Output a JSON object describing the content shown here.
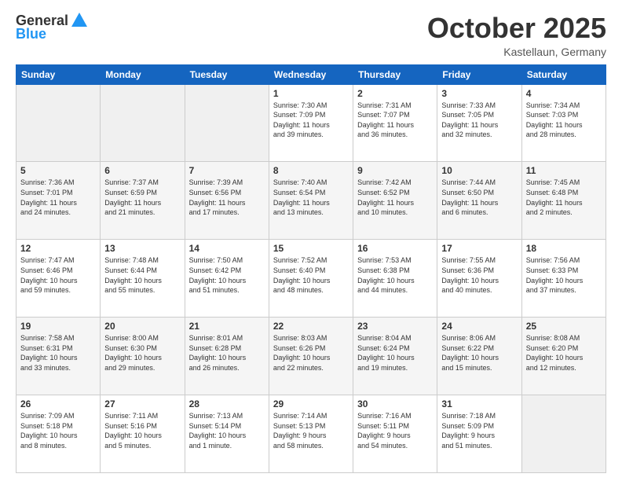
{
  "header": {
    "logo_general": "General",
    "logo_blue": "Blue",
    "month_title": "October 2025",
    "location": "Kastellaun, Germany"
  },
  "days_of_week": [
    "Sunday",
    "Monday",
    "Tuesday",
    "Wednesday",
    "Thursday",
    "Friday",
    "Saturday"
  ],
  "weeks": [
    {
      "days": [
        {
          "number": "",
          "detail": ""
        },
        {
          "number": "",
          "detail": ""
        },
        {
          "number": "",
          "detail": ""
        },
        {
          "number": "1",
          "detail": "Sunrise: 7:30 AM\nSunset: 7:09 PM\nDaylight: 11 hours\nand 39 minutes."
        },
        {
          "number": "2",
          "detail": "Sunrise: 7:31 AM\nSunset: 7:07 PM\nDaylight: 11 hours\nand 36 minutes."
        },
        {
          "number": "3",
          "detail": "Sunrise: 7:33 AM\nSunset: 7:05 PM\nDaylight: 11 hours\nand 32 minutes."
        },
        {
          "number": "4",
          "detail": "Sunrise: 7:34 AM\nSunset: 7:03 PM\nDaylight: 11 hours\nand 28 minutes."
        }
      ]
    },
    {
      "days": [
        {
          "number": "5",
          "detail": "Sunrise: 7:36 AM\nSunset: 7:01 PM\nDaylight: 11 hours\nand 24 minutes."
        },
        {
          "number": "6",
          "detail": "Sunrise: 7:37 AM\nSunset: 6:59 PM\nDaylight: 11 hours\nand 21 minutes."
        },
        {
          "number": "7",
          "detail": "Sunrise: 7:39 AM\nSunset: 6:56 PM\nDaylight: 11 hours\nand 17 minutes."
        },
        {
          "number": "8",
          "detail": "Sunrise: 7:40 AM\nSunset: 6:54 PM\nDaylight: 11 hours\nand 13 minutes."
        },
        {
          "number": "9",
          "detail": "Sunrise: 7:42 AM\nSunset: 6:52 PM\nDaylight: 11 hours\nand 10 minutes."
        },
        {
          "number": "10",
          "detail": "Sunrise: 7:44 AM\nSunset: 6:50 PM\nDaylight: 11 hours\nand 6 minutes."
        },
        {
          "number": "11",
          "detail": "Sunrise: 7:45 AM\nSunset: 6:48 PM\nDaylight: 11 hours\nand 2 minutes."
        }
      ]
    },
    {
      "days": [
        {
          "number": "12",
          "detail": "Sunrise: 7:47 AM\nSunset: 6:46 PM\nDaylight: 10 hours\nand 59 minutes."
        },
        {
          "number": "13",
          "detail": "Sunrise: 7:48 AM\nSunset: 6:44 PM\nDaylight: 10 hours\nand 55 minutes."
        },
        {
          "number": "14",
          "detail": "Sunrise: 7:50 AM\nSunset: 6:42 PM\nDaylight: 10 hours\nand 51 minutes."
        },
        {
          "number": "15",
          "detail": "Sunrise: 7:52 AM\nSunset: 6:40 PM\nDaylight: 10 hours\nand 48 minutes."
        },
        {
          "number": "16",
          "detail": "Sunrise: 7:53 AM\nSunset: 6:38 PM\nDaylight: 10 hours\nand 44 minutes."
        },
        {
          "number": "17",
          "detail": "Sunrise: 7:55 AM\nSunset: 6:36 PM\nDaylight: 10 hours\nand 40 minutes."
        },
        {
          "number": "18",
          "detail": "Sunrise: 7:56 AM\nSunset: 6:33 PM\nDaylight: 10 hours\nand 37 minutes."
        }
      ]
    },
    {
      "days": [
        {
          "number": "19",
          "detail": "Sunrise: 7:58 AM\nSunset: 6:31 PM\nDaylight: 10 hours\nand 33 minutes."
        },
        {
          "number": "20",
          "detail": "Sunrise: 8:00 AM\nSunset: 6:30 PM\nDaylight: 10 hours\nand 29 minutes."
        },
        {
          "number": "21",
          "detail": "Sunrise: 8:01 AM\nSunset: 6:28 PM\nDaylight: 10 hours\nand 26 minutes."
        },
        {
          "number": "22",
          "detail": "Sunrise: 8:03 AM\nSunset: 6:26 PM\nDaylight: 10 hours\nand 22 minutes."
        },
        {
          "number": "23",
          "detail": "Sunrise: 8:04 AM\nSunset: 6:24 PM\nDaylight: 10 hours\nand 19 minutes."
        },
        {
          "number": "24",
          "detail": "Sunrise: 8:06 AM\nSunset: 6:22 PM\nDaylight: 10 hours\nand 15 minutes."
        },
        {
          "number": "25",
          "detail": "Sunrise: 8:08 AM\nSunset: 6:20 PM\nDaylight: 10 hours\nand 12 minutes."
        }
      ]
    },
    {
      "days": [
        {
          "number": "26",
          "detail": "Sunrise: 7:09 AM\nSunset: 5:18 PM\nDaylight: 10 hours\nand 8 minutes."
        },
        {
          "number": "27",
          "detail": "Sunrise: 7:11 AM\nSunset: 5:16 PM\nDaylight: 10 hours\nand 5 minutes."
        },
        {
          "number": "28",
          "detail": "Sunrise: 7:13 AM\nSunset: 5:14 PM\nDaylight: 10 hours\nand 1 minute."
        },
        {
          "number": "29",
          "detail": "Sunrise: 7:14 AM\nSunset: 5:13 PM\nDaylight: 9 hours\nand 58 minutes."
        },
        {
          "number": "30",
          "detail": "Sunrise: 7:16 AM\nSunset: 5:11 PM\nDaylight: 9 hours\nand 54 minutes."
        },
        {
          "number": "31",
          "detail": "Sunrise: 7:18 AM\nSunset: 5:09 PM\nDaylight: 9 hours\nand 51 minutes."
        },
        {
          "number": "",
          "detail": ""
        }
      ]
    }
  ]
}
